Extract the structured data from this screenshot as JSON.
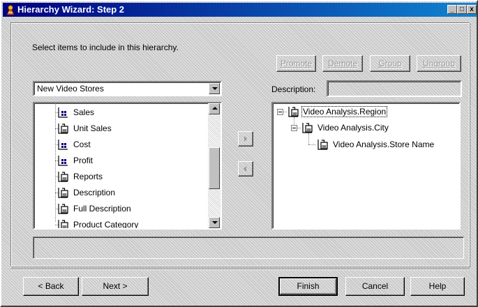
{
  "window": {
    "title": "Hierarchy Wizard: Step 2",
    "title_icon": "wizard-icon",
    "controls": {
      "minimize": "_",
      "maximize": "□",
      "close": "x"
    }
  },
  "instructions": "Select items to include in this hierarchy.",
  "hierarchy_buttons": [
    {
      "name": "promote-button",
      "label": "Promote",
      "enabled": false
    },
    {
      "name": "demote-button",
      "label": "Demote",
      "enabled": false
    },
    {
      "name": "group-button",
      "label": "Group",
      "enabled": false
    },
    {
      "name": "ungroup-button",
      "label": "Ungroup",
      "enabled": false
    }
  ],
  "source_combo": {
    "value": "New Video Stores"
  },
  "description": {
    "label": "Description:",
    "value": ""
  },
  "source_items": [
    {
      "label": "Sales",
      "icon": "measure-icon"
    },
    {
      "label": "Unit Sales",
      "icon": "dimension-icon"
    },
    {
      "label": "Cost",
      "icon": "measure-icon"
    },
    {
      "label": "Profit",
      "icon": "measure-icon"
    },
    {
      "label": "Reports",
      "icon": "dimension-icon"
    },
    {
      "label": "Description",
      "icon": "dimension-icon"
    },
    {
      "label": "Full Description",
      "icon": "dimension-icon"
    },
    {
      "label": "Product Category",
      "icon": "dimension-icon"
    }
  ],
  "hierarchy_tree": [
    {
      "label": "Video Analysis.Region",
      "level": 0,
      "selected": true
    },
    {
      "label": "Video Analysis.City",
      "level": 1,
      "selected": false
    },
    {
      "label": "Video Analysis.Store Name",
      "level": 2,
      "selected": false
    }
  ],
  "move_buttons": {
    "add_icon": "arrow-right-icon",
    "remove_icon": "arrow-left-icon"
  },
  "nav": {
    "back": "< Back",
    "back_mnemonic": "B",
    "next": "Next >",
    "next_mnemonic": "N",
    "finish": "Finish",
    "cancel": "Cancel",
    "help": "Help"
  },
  "colors": {
    "title_start": "#000080",
    "title_end": "#1084d0",
    "face": "#c0c0c0"
  }
}
